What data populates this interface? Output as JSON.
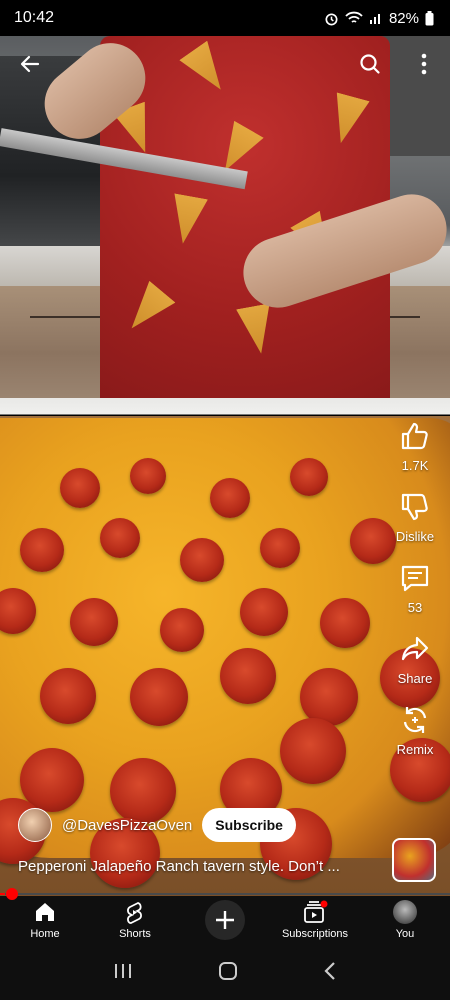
{
  "status": {
    "time": "10:42",
    "battery": "82%"
  },
  "actions": {
    "like_count": "1.7K",
    "dislike_label": "Dislike",
    "comment_count": "53",
    "share_label": "Share",
    "remix_label": "Remix"
  },
  "channel": {
    "handle": "@DavesPizzaOven",
    "subscribe_label": "Subscribe"
  },
  "caption": "Pepperoni Jalapeño Ranch tavern style. Don’t  ...",
  "progress_fraction": 0.01,
  "nav": {
    "home": "Home",
    "shorts": "Shorts",
    "subscriptions": "Subscriptions",
    "you": "You"
  },
  "colors": {
    "accent": "#ff0000",
    "nav_bg": "#0f0f0f"
  }
}
